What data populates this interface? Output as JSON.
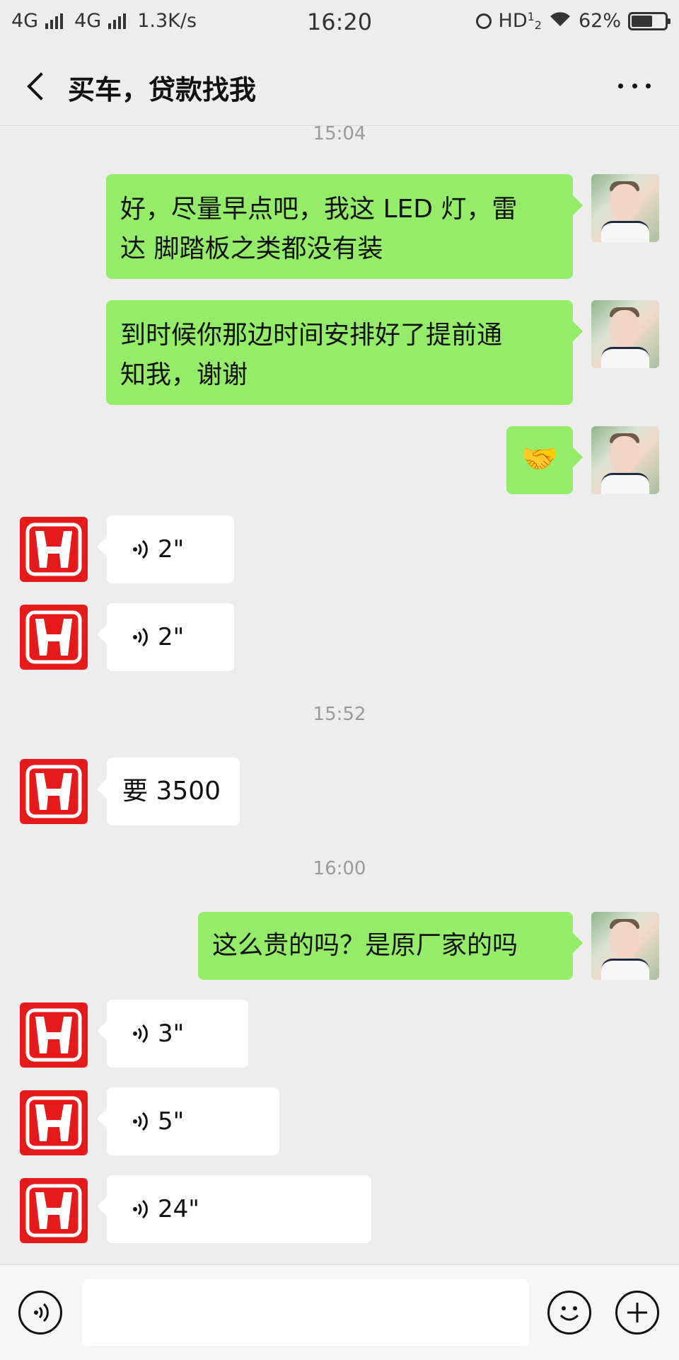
{
  "status_bar": {
    "net1": "4G",
    "net2": "4G",
    "speed": "1.3K/s",
    "time": "16:20",
    "hd": "HD",
    "hd_sup": "1",
    "hd_sub": "2",
    "battery": "62%",
    "battery_level": 0.62
  },
  "header": {
    "title": "买车，贷款找我"
  },
  "chat": {
    "ts_top": "15:04",
    "m1": "好，尽量早点吧，我这 LED 灯，雷达 脚踏板之类都没有装",
    "m1_line1": "好，尽量早点吧，我这 LED 灯，雷",
    "m1_line2": "达 脚踏板之类都没有装",
    "m2_line1": "到时候你那边时间安排好了提前通",
    "m2_line2": "知我，谢谢",
    "m3_emoji": "🤝",
    "v1": "2\"",
    "v2": "2\"",
    "ts_mid": "15:52",
    "m4": "要 3500",
    "ts_late": "16:00",
    "m5": "这么贵的吗？是原厂家的吗",
    "v3": "3\"",
    "v4": "5\"",
    "v5": "24\""
  },
  "input_bar": {
    "placeholder": ""
  },
  "colors": {
    "my_bubble": "#95ec69",
    "other_bubble": "#ffffff",
    "background": "#ededed",
    "honda_red": "#e51a1a"
  }
}
